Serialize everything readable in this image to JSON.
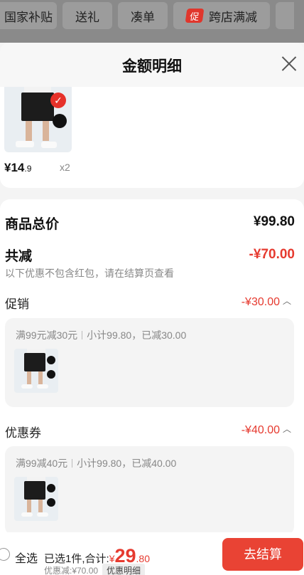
{
  "topbar": {
    "chips": [
      "国家补贴",
      "送礼",
      "凑单",
      "跨店满减"
    ],
    "promo_badge": "促"
  },
  "sheet": {
    "title": "金额明细"
  },
  "product": {
    "price_int": "¥14",
    "price_dec": ".9",
    "qty": "x2",
    "icon": "checked-badge-icon"
  },
  "summary": {
    "total_label": "商品总价",
    "total_value": "¥99.80",
    "discount_label": "共减",
    "discount_value": "-¥70.00",
    "discount_note": "以下优惠不包含红包，请在结算页查看",
    "promotion": {
      "label": "促销",
      "value": "-¥30.00",
      "rule": "满99元减30元",
      "subtotal": "小计99.80，已减30.00"
    },
    "coupon": {
      "label": "优惠券",
      "value": "-¥40.00",
      "rule": "满99减40元",
      "subtotal": "小计99.80，已减40.00"
    }
  },
  "bottom": {
    "select_all": "全选",
    "selected_text": "已选1件,合计:",
    "yen": "¥",
    "total_int": "29",
    "total_dec": ".80",
    "saved_text": "优惠减:¥70.00",
    "detail_chip": "优惠明细",
    "checkout": "去结算"
  },
  "colors": {
    "accent_red": "#e63a2f",
    "button_red": "#e94334",
    "background": "#f4f4f4"
  }
}
